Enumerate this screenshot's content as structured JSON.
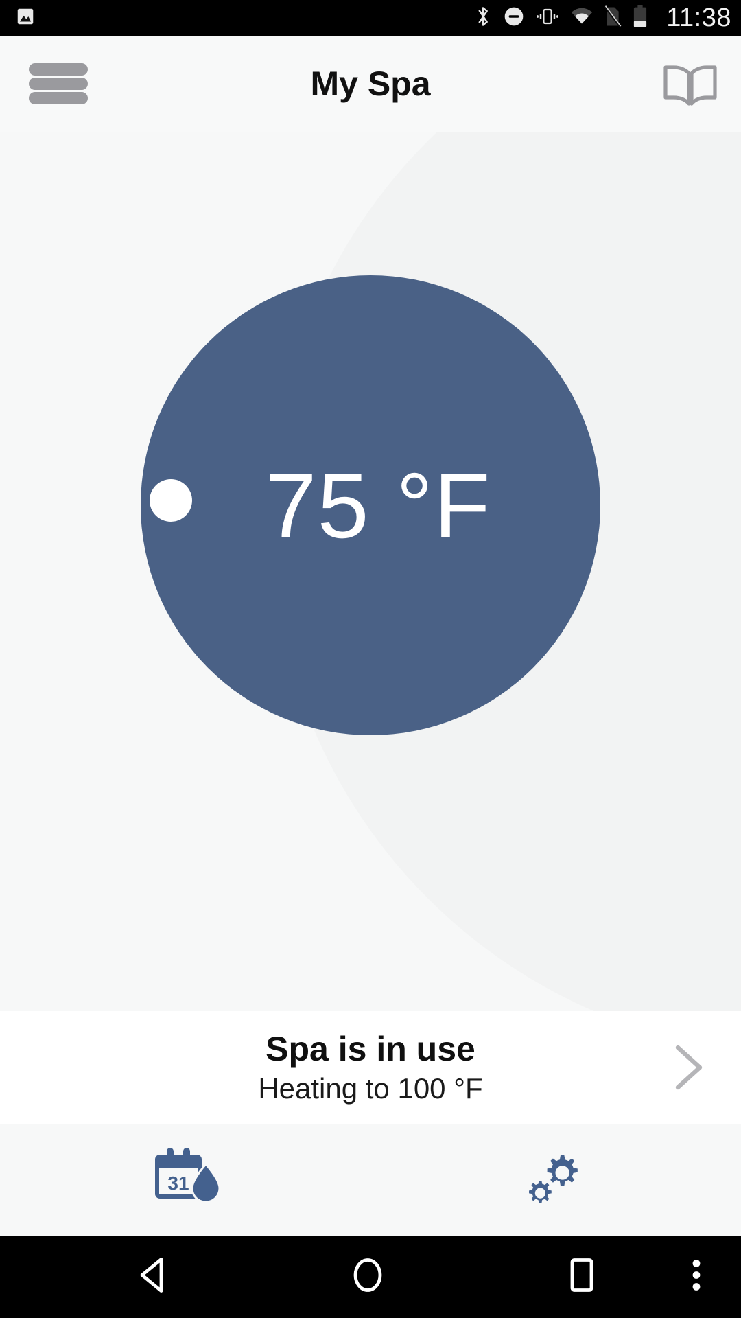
{
  "status_bar": {
    "clock": "11:38",
    "left_icons": [
      {
        "name": "image-notification-icon",
        "label": "Screenshot"
      }
    ],
    "right_icons": [
      {
        "name": "bluetooth-icon",
        "label": "Bluetooth"
      },
      {
        "name": "do-not-disturb-icon",
        "label": "Do not disturb"
      },
      {
        "name": "vibrate-icon",
        "label": "Vibrate"
      },
      {
        "name": "wifi-icon",
        "label": "Wi-Fi"
      },
      {
        "name": "no-sim-icon",
        "label": "No SIM"
      },
      {
        "name": "battery-icon",
        "label": "Battery"
      }
    ]
  },
  "header": {
    "title": "My Spa",
    "menu_label": "Menu",
    "manual_label": "Manual"
  },
  "dial": {
    "temperature": "75 °F",
    "value": 75,
    "unit": "°F",
    "handle_label": "Temperature handle",
    "color": "#4A6186",
    "handle_color": "#FFFFFF"
  },
  "status_card": {
    "title": "Spa is in use",
    "subtitle": "Heating to 100 °F",
    "target_temperature": 100,
    "chevron_label": "Open details"
  },
  "tab_bar": {
    "items": [
      {
        "name": "tab-water-care",
        "icon": "calendar-water-drop-icon",
        "label": "Water care",
        "badge": "31"
      },
      {
        "name": "tab-settings",
        "icon": "gears-icon",
        "label": "Settings"
      }
    ],
    "icon_color": "#4A6186"
  },
  "nav_bar": {
    "buttons": [
      {
        "name": "nav-back-button",
        "icon": "triangle-back-icon",
        "label": "Back"
      },
      {
        "name": "nav-home-button",
        "icon": "circle-home-icon",
        "label": "Home"
      },
      {
        "name": "nav-recents-button",
        "icon": "square-recents-icon",
        "label": "Recents"
      },
      {
        "name": "nav-overflow-button",
        "icon": "three-dots-icon",
        "label": "More"
      }
    ]
  }
}
